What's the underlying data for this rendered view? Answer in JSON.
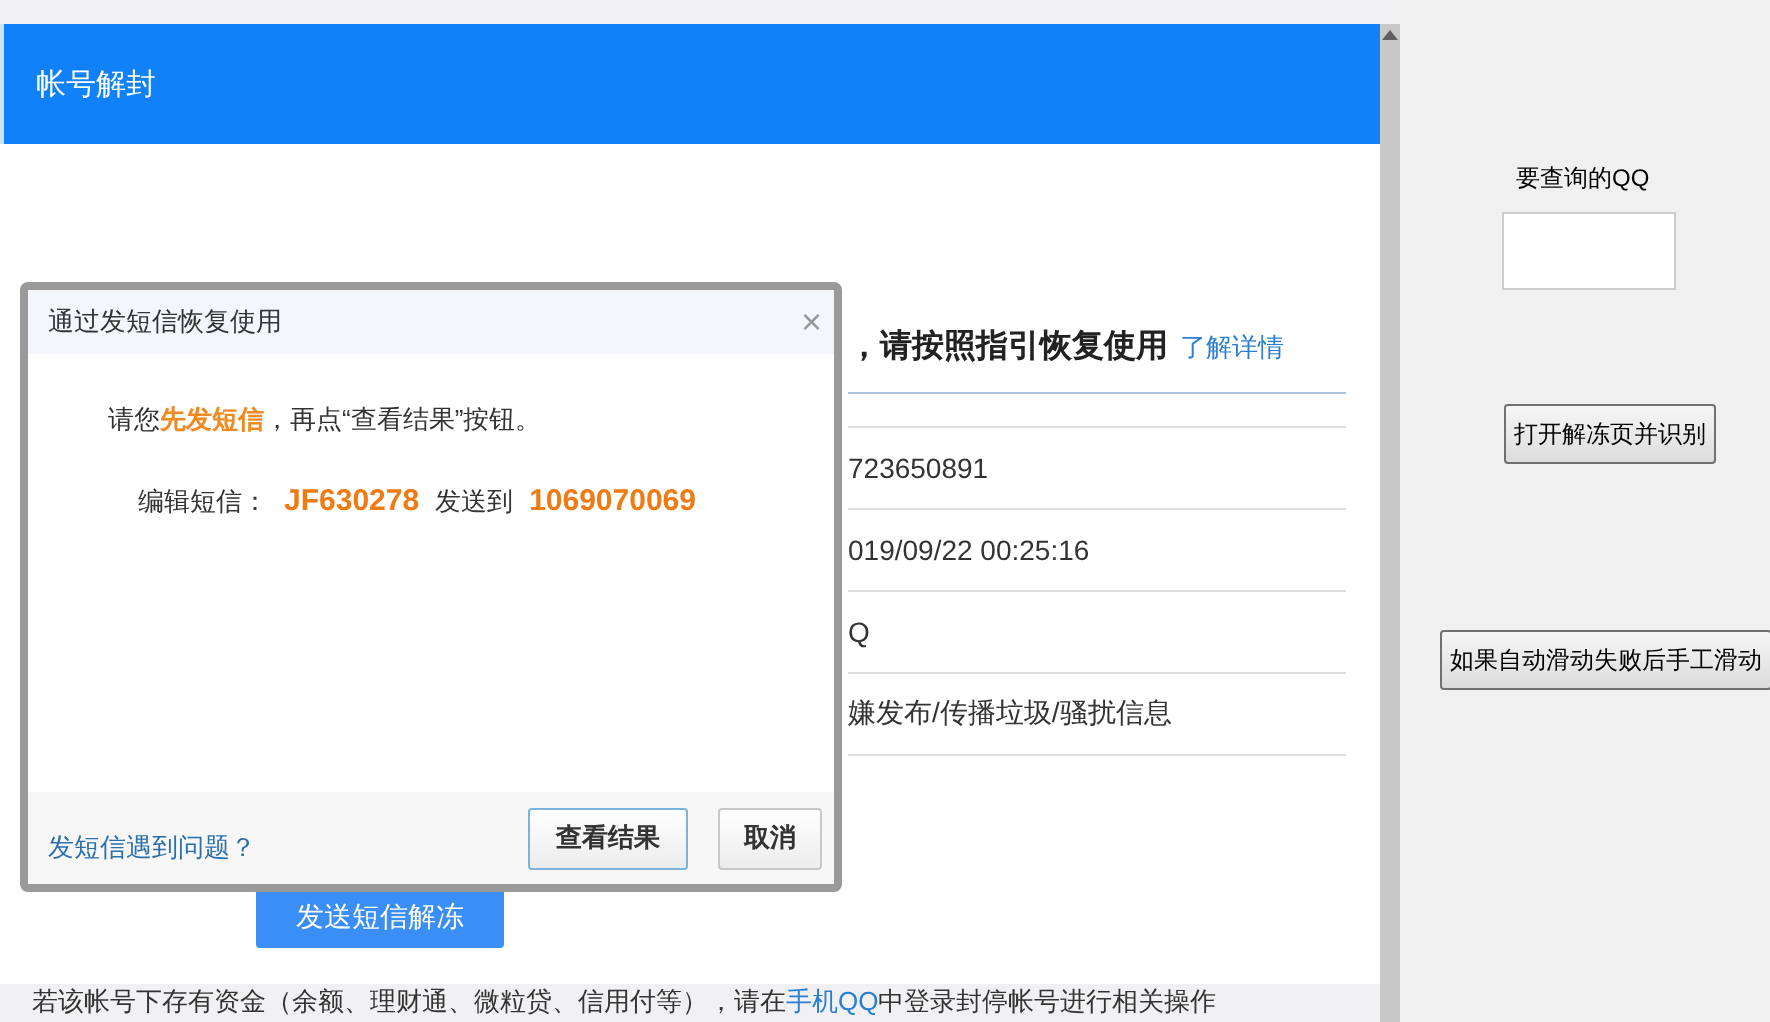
{
  "web_page": {
    "title": "帐号解封",
    "heading": "，请按照指引恢复使用",
    "heading_link": "了解详情",
    "rows": [
      "723650891",
      "019/09/22  00:25:16",
      "Q",
      "嫌发布/传播垃圾/骚扰信息"
    ],
    "send_button": "发送短信解冻",
    "notice": {
      "before": "若该帐号下存有资金（余额、理财通、微粒贷、信用付等），请在",
      "link": "手机QQ",
      "after": "中登录封停帐号进行相关操作"
    }
  },
  "dialog": {
    "title": "通过发短信恢复使用",
    "close": "×",
    "message": "请您**先发短信**，再点“查看结果”按钮。",
    "sms_label": "编辑短信：",
    "sms_code": "JF630278",
    "sms_to": "发送到",
    "sms_number": "1069070069",
    "help_link": "发短信遇到问题？",
    "buttons": [
      {
        "label": "查看结果",
        "focused": true
      },
      {
        "label": "取消",
        "focused": false
      }
    ]
  },
  "tool_panel": {
    "qq_label": "要查询的QQ",
    "buttons": [
      "打开解冻页并识别",
      "如果自动滑动失败后手工滑动"
    ]
  }
}
